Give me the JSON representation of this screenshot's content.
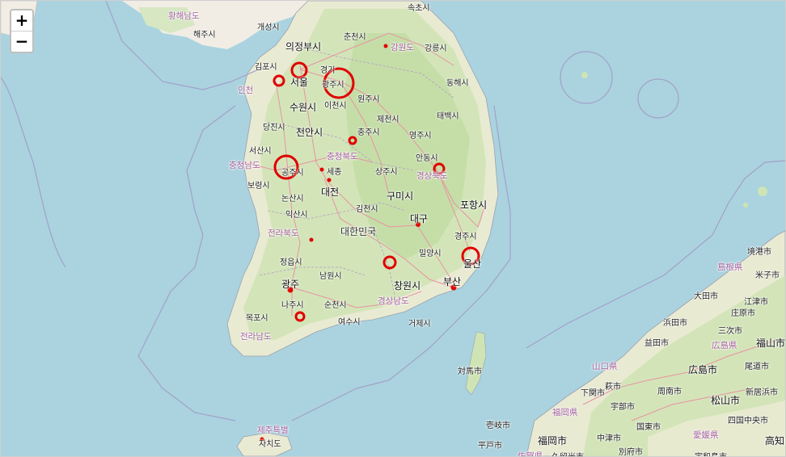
{
  "controls": {
    "zoom_in": "+",
    "zoom_out": "−"
  },
  "colors": {
    "sea": "#aad3df",
    "land": "#f1ede4",
    "green": "#cfe4b4",
    "road": "#e892a2",
    "border": "#a3a0c8",
    "marker": "#e00000"
  },
  "labels": [
    {
      "text": "황해남도",
      "cls": "prov"
    },
    {
      "text": "해주시",
      "cls": ""
    },
    {
      "text": "개성시",
      "cls": ""
    },
    {
      "text": "속초시",
      "cls": ""
    },
    {
      "text": "의정부시",
      "cls": "big"
    },
    {
      "text": "춘천시",
      "cls": ""
    },
    {
      "text": "강원도",
      "cls": "prov"
    },
    {
      "text": "강릉시",
      "cls": ""
    },
    {
      "text": "김포시",
      "cls": ""
    },
    {
      "text": "경기",
      "cls": ""
    },
    {
      "text": "서울",
      "cls": "big"
    },
    {
      "text": "광주시",
      "cls": ""
    },
    {
      "text": "동해시",
      "cls": ""
    },
    {
      "text": "인천",
      "cls": "prov"
    },
    {
      "text": "수원시",
      "cls": "big"
    },
    {
      "text": "이천시",
      "cls": ""
    },
    {
      "text": "원주시",
      "cls": ""
    },
    {
      "text": "태백시",
      "cls": ""
    },
    {
      "text": "당진시",
      "cls": ""
    },
    {
      "text": "제천시",
      "cls": ""
    },
    {
      "text": "천안시",
      "cls": "big"
    },
    {
      "text": "충주시",
      "cls": ""
    },
    {
      "text": "영주시",
      "cls": ""
    },
    {
      "text": "서산시",
      "cls": ""
    },
    {
      "text": "충청북도",
      "cls": "prov"
    },
    {
      "text": "안동시",
      "cls": ""
    },
    {
      "text": "충청남도",
      "cls": "prov"
    },
    {
      "text": "공주시",
      "cls": ""
    },
    {
      "text": "세종",
      "cls": ""
    },
    {
      "text": "상주시",
      "cls": ""
    },
    {
      "text": "경상북도",
      "cls": "prov"
    },
    {
      "text": "보령시",
      "cls": ""
    },
    {
      "text": "대전",
      "cls": "big"
    },
    {
      "text": "구미시",
      "cls": "big"
    },
    {
      "text": "논산시",
      "cls": ""
    },
    {
      "text": "포항시",
      "cls": "big"
    },
    {
      "text": "익산시",
      "cls": ""
    },
    {
      "text": "김천시",
      "cls": ""
    },
    {
      "text": "대구",
      "cls": "big"
    },
    {
      "text": "전라북도",
      "cls": "prov"
    },
    {
      "text": "대한민국",
      "cls": "country"
    },
    {
      "text": "경주시",
      "cls": ""
    },
    {
      "text": "밀양시",
      "cls": ""
    },
    {
      "text": "정읍시",
      "cls": ""
    },
    {
      "text": "울산",
      "cls": "big"
    },
    {
      "text": "남원시",
      "cls": ""
    },
    {
      "text": "광주",
      "cls": "big"
    },
    {
      "text": "창원시",
      "cls": "big"
    },
    {
      "text": "부산",
      "cls": "big"
    },
    {
      "text": "나주시",
      "cls": ""
    },
    {
      "text": "순천시",
      "cls": ""
    },
    {
      "text": "경상남도",
      "cls": "prov"
    },
    {
      "text": "목포시",
      "cls": ""
    },
    {
      "text": "여수시",
      "cls": ""
    },
    {
      "text": "거제시",
      "cls": ""
    },
    {
      "text": "전라남도",
      "cls": "prov"
    },
    {
      "text": "対馬市",
      "cls": ""
    },
    {
      "text": "境港市",
      "cls": ""
    },
    {
      "text": "島根県",
      "cls": "prov"
    },
    {
      "text": "米子市",
      "cls": ""
    },
    {
      "text": "大田市",
      "cls": ""
    },
    {
      "text": "江津市",
      "cls": ""
    },
    {
      "text": "庄原市",
      "cls": ""
    },
    {
      "text": "浜田市",
      "cls": ""
    },
    {
      "text": "三次市",
      "cls": ""
    },
    {
      "text": "益田市",
      "cls": ""
    },
    {
      "text": "広島県",
      "cls": "prov"
    },
    {
      "text": "福山市",
      "cls": "big"
    },
    {
      "text": "山口県",
      "cls": "prov"
    },
    {
      "text": "広島市",
      "cls": "big"
    },
    {
      "text": "尾道市",
      "cls": ""
    },
    {
      "text": "萩市",
      "cls": ""
    },
    {
      "text": "周南市",
      "cls": ""
    },
    {
      "text": "新居浜市",
      "cls": ""
    },
    {
      "text": "下関市",
      "cls": ""
    },
    {
      "text": "宇部市",
      "cls": ""
    },
    {
      "text": "松山市",
      "cls": "big"
    },
    {
      "text": "福岡県",
      "cls": "prov"
    },
    {
      "text": "壱岐市",
      "cls": ""
    },
    {
      "text": "国東市",
      "cls": ""
    },
    {
      "text": "四国中央市",
      "cls": ""
    },
    {
      "text": "福岡市",
      "cls": "big"
    },
    {
      "text": "中津市",
      "cls": ""
    },
    {
      "text": "愛媛県",
      "cls": "prov"
    },
    {
      "text": "平戸市",
      "cls": ""
    },
    {
      "text": "佐賀県",
      "cls": "prov"
    },
    {
      "text": "久留米市",
      "cls": ""
    },
    {
      "text": "別府市",
      "cls": ""
    },
    {
      "text": "宇和島市",
      "cls": ""
    },
    {
      "text": "高知",
      "cls": "big"
    },
    {
      "text": "제주특별",
      "cls": "prov"
    },
    {
      "text": "자치도",
      "cls": ""
    }
  ]
}
